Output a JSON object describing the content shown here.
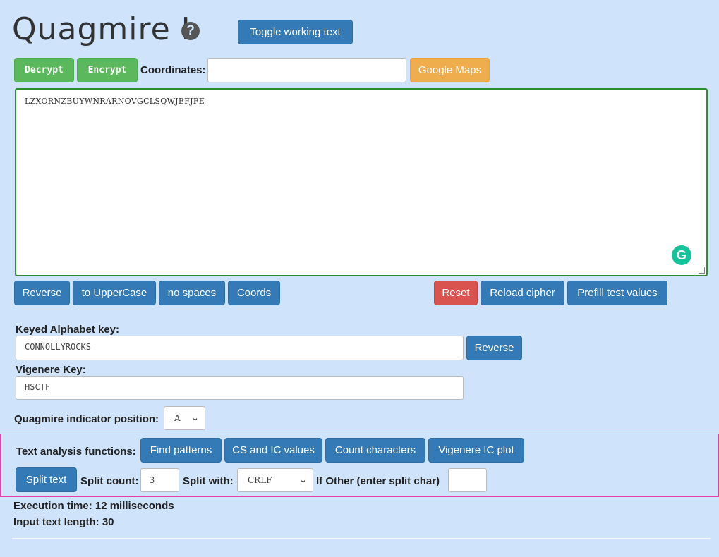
{
  "header": {
    "title": "Quagmire I",
    "help_icon": "question-circle-icon",
    "toggle_label": "Toggle working text"
  },
  "toolbar": {
    "decrypt_label": "Decrypt",
    "encrypt_label": "Encrypt",
    "coordinates_label": "Coordinates:",
    "coordinates_value": "",
    "google_maps_label": "Google Maps"
  },
  "main_text": {
    "value": "LZXORNZBUYWNRARNOVGCLSQWJEFJFE",
    "grammarly_icon": "grammarly-icon"
  },
  "text_buttons": {
    "reverse": "Reverse",
    "uppercase": "to UpperCase",
    "no_spaces": "no spaces",
    "coords": "Coords",
    "reset": "Reset",
    "reload": "Reload cipher",
    "prefill": "Prefill test values"
  },
  "keyed_alphabet": {
    "label": "Keyed Alphabet key:",
    "value": "CONNOLLYROCKS",
    "reverse_label": "Reverse"
  },
  "vigenere": {
    "label": "Vigenere Key:",
    "value": "HSCTF"
  },
  "indicator": {
    "label": "Quagmire indicator position:",
    "selected": "A"
  },
  "analysis": {
    "label": "Text analysis functions:",
    "find_patterns": "Find patterns",
    "cs_ic": "CS and IC values",
    "count_chars": "Count characters",
    "vigenere_ic": "Vigenere IC plot",
    "split_text": "Split text",
    "split_count_label": "Split count:",
    "split_count_value": "3",
    "split_with_label": "Split with:",
    "split_with_selected": "CRLF",
    "other_label": "If Other (enter split char)",
    "other_value": ""
  },
  "stats": {
    "execution": "Execution time: 12 milliseconds",
    "length": "Input text length: 30"
  },
  "colors": {
    "background": "#cfe3fb",
    "primary": "#337ab7",
    "success": "#5cb85c",
    "warning": "#f0ad4e",
    "danger": "#d9534f"
  }
}
